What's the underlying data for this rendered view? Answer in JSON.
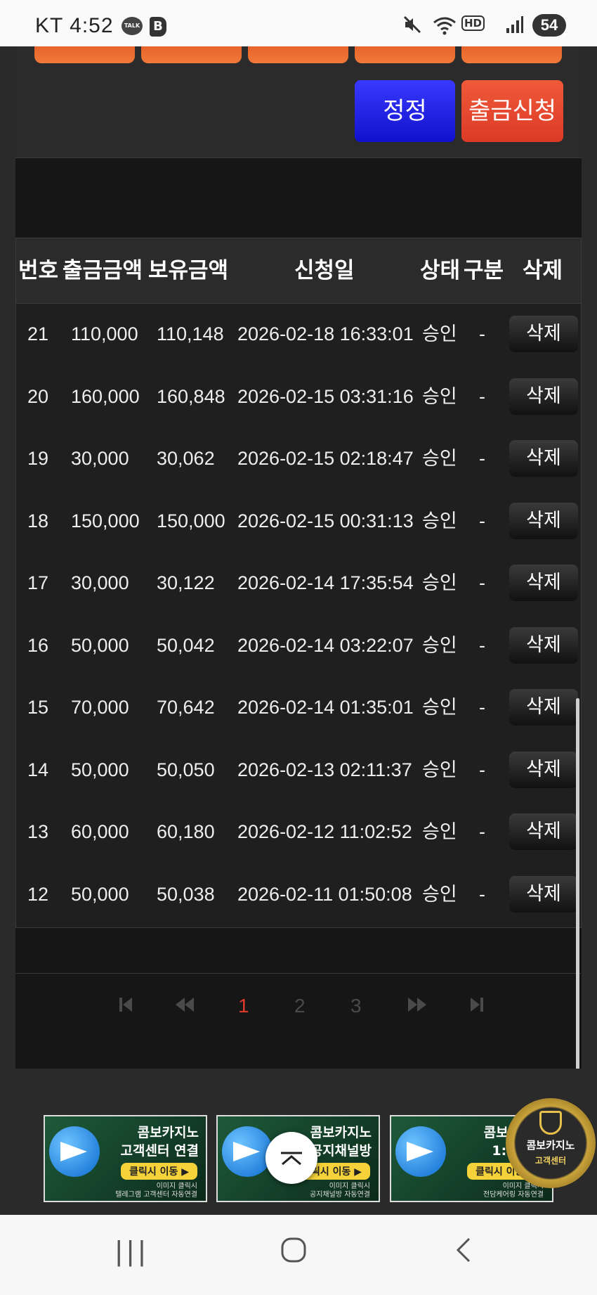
{
  "status_bar": {
    "carrier_time": "KT 4:52",
    "talk_icon_label": "TALK",
    "b_icon_label": "B",
    "hd_label": "HD",
    "battery": "54",
    "icons": [
      "mute-icon",
      "wifi-icon",
      "hd-icon",
      "signal-icon",
      "battery-icon"
    ]
  },
  "actions": {
    "correct_label": "정정",
    "withdraw_label": "출금신청"
  },
  "table": {
    "headers": [
      "번호",
      "출금금액",
      "보유금액",
      "신청일",
      "상태",
      "구분",
      "삭제"
    ],
    "rows": [
      {
        "no": "21",
        "amount": "110,000",
        "balance": "110,148",
        "date": "2026-02-18 16:33:01",
        "status": "승인",
        "type": "-",
        "delete": "삭제"
      },
      {
        "no": "20",
        "amount": "160,000",
        "balance": "160,848",
        "date": "2026-02-15 03:31:16",
        "status": "승인",
        "type": "-",
        "delete": "삭제"
      },
      {
        "no": "19",
        "amount": "30,000",
        "balance": "30,062",
        "date": "2026-02-15 02:18:47",
        "status": "승인",
        "type": "-",
        "delete": "삭제"
      },
      {
        "no": "18",
        "amount": "150,000",
        "balance": "150,000",
        "date": "2026-02-15 00:31:13",
        "status": "승인",
        "type": "-",
        "delete": "삭제"
      },
      {
        "no": "17",
        "amount": "30,000",
        "balance": "30,122",
        "date": "2026-02-14 17:35:54",
        "status": "승인",
        "type": "-",
        "delete": "삭제"
      },
      {
        "no": "16",
        "amount": "50,000",
        "balance": "50,042",
        "date": "2026-02-14 03:22:07",
        "status": "승인",
        "type": "-",
        "delete": "삭제"
      },
      {
        "no": "15",
        "amount": "70,000",
        "balance": "70,642",
        "date": "2026-02-14 01:35:01",
        "status": "승인",
        "type": "-",
        "delete": "삭제"
      },
      {
        "no": "14",
        "amount": "50,000",
        "balance": "50,050",
        "date": "2026-02-13 02:11:37",
        "status": "승인",
        "type": "-",
        "delete": "삭제"
      },
      {
        "no": "13",
        "amount": "60,000",
        "balance": "60,180",
        "date": "2026-02-12 11:02:52",
        "status": "승인",
        "type": "-",
        "delete": "삭제"
      },
      {
        "no": "12",
        "amount": "50,000",
        "balance": "50,038",
        "date": "2026-02-11 01:50:08",
        "status": "승인",
        "type": "-",
        "delete": "삭제"
      }
    ]
  },
  "pagination": {
    "first_icon": "first-page-icon",
    "prev_icon": "prev-page-icon",
    "pages": [
      "1",
      "2",
      "3"
    ],
    "current": "1",
    "next_icon": "next-page-icon",
    "last_icon": "last-page-icon"
  },
  "banners": [
    {
      "title_1": "콤보카지노",
      "title_2": "고객센터 연결",
      "button": "클릭시 이동 ▶",
      "sub_1": "이미지 클릭시",
      "sub_2": "텔레그램 고객센터 자동연결"
    },
    {
      "title_1": "콤보카지노",
      "title_2": "공지채널방",
      "button": "클릭시 이동 ▶",
      "sub_1": "이미지 클릭시",
      "sub_2": "공지채널방 자동연결"
    },
    {
      "title_1": "콤보카지노",
      "title_2": "1:1 전담",
      "button": "클릭시 이동 ▶",
      "sub_1": "이미지 클릭시",
      "sub_2": "전담케어링 자동연결"
    }
  ],
  "cs_badge": {
    "line_1": "콤보카지노",
    "line_2": "고객센터"
  },
  "scroll_top_icon": "chevron-up-icon",
  "nav": {
    "recent_icon": "|||",
    "home_icon": "○",
    "back_icon": "<"
  }
}
